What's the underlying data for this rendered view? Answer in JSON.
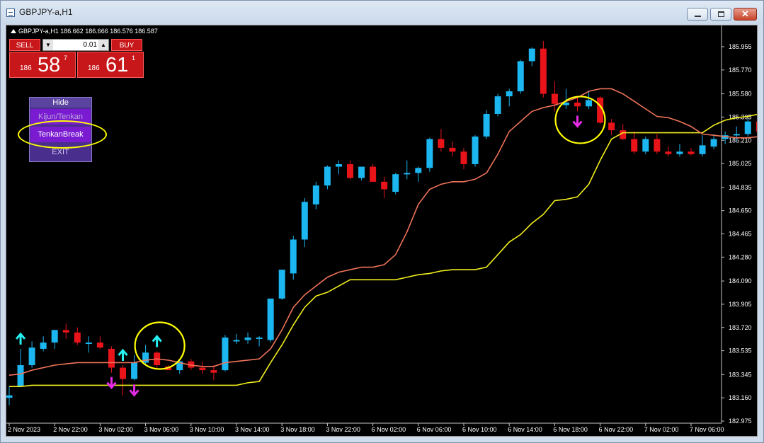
{
  "window": {
    "title": "GBPJPY-a,H1"
  },
  "chart_header": {
    "text": "GBPJPY-a,H1  186.662 186.666 186.576 186.587"
  },
  "trade_panel": {
    "sell_label": "SELL",
    "buy_label": "BUY",
    "lot": "0.01",
    "sell_price": {
      "prefix": "186",
      "big": "58",
      "frac": "7"
    },
    "buy_price": {
      "prefix": "186",
      "big": "61",
      "frac": "1"
    }
  },
  "menu": {
    "hide": "Hide",
    "kijun": "Kijun/Tenkan",
    "tenkan": "TenkanBreak",
    "exit": "EXIT"
  },
  "colors": {
    "bull": "#1cb6f0",
    "bear": "#e8141a",
    "tenkan": "#f0735a",
    "kijun": "#f2ee1c",
    "up_arrow": "#27f0f0",
    "down_arrow": "#e42ce4",
    "highlight": "#ffff00"
  },
  "chart_data": {
    "type": "candlestick",
    "price_ticks": [
      "185.955",
      "185.770",
      "185.580",
      "185.395",
      "185.210",
      "185.025",
      "184.835",
      "184.650",
      "184.465",
      "184.280",
      "184.090",
      "183.905",
      "183.720",
      "183.535",
      "183.345",
      "183.160",
      "182.975"
    ],
    "time_labels": [
      "2 Nov 2023",
      "2 Nov 22:00",
      "3 Nov 02:00",
      "3 Nov 06:00",
      "3 Nov 10:00",
      "3 Nov 14:00",
      "3 Nov 18:00",
      "3 Nov 22:00",
      "6 Nov 02:00",
      "6 Nov 06:00",
      "6 Nov 10:00",
      "6 Nov 14:00",
      "6 Nov 18:00",
      "6 Nov 22:00",
      "7 Nov 02:00",
      "7 Nov 06:00"
    ],
    "ylim": [
      182.975,
      185.955
    ],
    "candles": [
      [
        183.16,
        183.25,
        183.1,
        183.18
      ],
      [
        183.25,
        183.55,
        183.25,
        183.42
      ],
      [
        183.42,
        183.61,
        183.4,
        183.56
      ],
      [
        183.55,
        183.65,
        183.53,
        183.6
      ],
      [
        183.6,
        183.7,
        183.55,
        183.7
      ],
      [
        183.7,
        183.75,
        183.63,
        183.68
      ],
      [
        183.68,
        183.72,
        183.58,
        183.6
      ],
      [
        183.6,
        183.65,
        183.52,
        183.6
      ],
      [
        183.6,
        183.65,
        183.55,
        183.56
      ],
      [
        183.55,
        183.57,
        183.36,
        183.4
      ],
      [
        183.4,
        183.42,
        183.18,
        183.31
      ],
      [
        183.31,
        183.5,
        183.3,
        183.44
      ],
      [
        183.44,
        183.58,
        183.42,
        183.52
      ],
      [
        183.52,
        183.53,
        183.4,
        183.42
      ],
      [
        183.41,
        183.42,
        183.38,
        183.38
      ],
      [
        183.38,
        183.46,
        183.35,
        183.45
      ],
      [
        183.45,
        183.47,
        183.38,
        183.4
      ],
      [
        183.4,
        183.45,
        183.35,
        183.38
      ],
      [
        183.38,
        183.42,
        183.3,
        183.36
      ],
      [
        183.38,
        183.66,
        183.37,
        183.64
      ],
      [
        183.62,
        183.67,
        183.59,
        183.62
      ],
      [
        183.62,
        183.68,
        183.59,
        183.64
      ],
      [
        183.63,
        183.65,
        183.57,
        183.64
      ],
      [
        183.62,
        183.95,
        183.6,
        183.95
      ],
      [
        183.95,
        184.18,
        183.94,
        184.18
      ],
      [
        184.15,
        184.45,
        184.1,
        184.42
      ],
      [
        184.42,
        184.75,
        184.36,
        184.72
      ],
      [
        184.7,
        184.88,
        184.66,
        184.85
      ],
      [
        184.85,
        185.01,
        184.82,
        185.0
      ],
      [
        185.0,
        185.05,
        184.94,
        185.02
      ],
      [
        185.02,
        185.05,
        184.9,
        184.91
      ],
      [
        184.91,
        185.0,
        184.89,
        185.0
      ],
      [
        185.0,
        185.02,
        184.88,
        184.88
      ],
      [
        184.88,
        184.92,
        184.75,
        184.82
      ],
      [
        184.8,
        184.95,
        184.78,
        184.94
      ],
      [
        184.94,
        185.05,
        184.9,
        184.95
      ],
      [
        184.95,
        185.0,
        184.88,
        184.99
      ],
      [
        184.99,
        185.23,
        184.96,
        185.22
      ],
      [
        185.22,
        185.3,
        185.12,
        185.15
      ],
      [
        185.15,
        185.2,
        185.08,
        185.12
      ],
      [
        185.12,
        185.15,
        184.98,
        185.02
      ],
      [
        185.02,
        185.25,
        185.0,
        185.24
      ],
      [
        185.24,
        185.45,
        185.22,
        185.42
      ],
      [
        185.42,
        185.58,
        185.4,
        185.56
      ],
      [
        185.56,
        185.62,
        185.48,
        185.6
      ],
      [
        185.6,
        185.85,
        185.58,
        185.84
      ],
      [
        185.84,
        185.95,
        185.8,
        185.94
      ],
      [
        185.94,
        186.0,
        185.55,
        185.58
      ],
      [
        185.58,
        185.68,
        185.44,
        185.5
      ],
      [
        185.49,
        185.62,
        185.46,
        185.51
      ],
      [
        185.51,
        185.56,
        185.44,
        185.48
      ],
      [
        185.48,
        185.6,
        185.46,
        185.53
      ],
      [
        185.55,
        185.56,
        185.34,
        185.35
      ],
      [
        185.35,
        185.38,
        185.25,
        185.29
      ],
      [
        185.29,
        185.34,
        185.21,
        185.22
      ],
      [
        185.22,
        185.28,
        185.1,
        185.12
      ],
      [
        185.12,
        185.24,
        185.1,
        185.22
      ],
      [
        185.22,
        185.26,
        185.1,
        185.12
      ],
      [
        185.12,
        185.16,
        185.08,
        185.1
      ],
      [
        185.1,
        185.18,
        185.08,
        185.12
      ],
      [
        185.12,
        185.15,
        185.09,
        185.1
      ],
      [
        185.1,
        185.25,
        185.08,
        185.17
      ],
      [
        185.16,
        185.26,
        185.14,
        185.22
      ],
      [
        185.22,
        185.28,
        185.18,
        185.25
      ],
      [
        185.25,
        185.32,
        185.2,
        185.26
      ],
      [
        185.26,
        185.38,
        185.24,
        185.36
      ],
      [
        185.36,
        185.4,
        185.24,
        185.28
      ],
      [
        185.28,
        185.36,
        185.2,
        185.34
      ]
    ],
    "tenkan": [
      183.34,
      183.35,
      183.38,
      183.4,
      183.42,
      183.43,
      183.44,
      183.44,
      183.44,
      183.44,
      183.44,
      183.44,
      183.46,
      183.47,
      183.46,
      183.44,
      183.42,
      183.41,
      183.41,
      183.44,
      183.45,
      183.46,
      183.47,
      183.55,
      183.7,
      183.88,
      183.98,
      184.05,
      184.12,
      184.16,
      184.18,
      184.2,
      184.2,
      184.22,
      184.3,
      184.48,
      184.7,
      184.82,
      184.86,
      184.88,
      184.88,
      184.9,
      184.95,
      185.1,
      185.28,
      185.36,
      185.44,
      185.47,
      185.49,
      185.52,
      185.55,
      185.6,
      185.62,
      185.62,
      185.58,
      185.52,
      185.46,
      185.4,
      185.39,
      185.36,
      185.32,
      185.26,
      185.25,
      185.24,
      185.23,
      185.23,
      185.24,
      185.24
    ],
    "kijun": [
      183.25,
      183.25,
      183.26,
      183.26,
      183.26,
      183.26,
      183.26,
      183.26,
      183.26,
      183.26,
      183.26,
      183.26,
      183.26,
      183.26,
      183.26,
      183.26,
      183.26,
      183.26,
      183.26,
      183.26,
      183.26,
      183.28,
      183.29,
      183.44,
      183.58,
      183.74,
      183.88,
      183.97,
      184.0,
      184.05,
      184.1,
      184.1,
      184.1,
      184.1,
      184.1,
      184.12,
      184.14,
      184.15,
      184.17,
      184.18,
      184.18,
      184.18,
      184.2,
      184.3,
      184.4,
      184.46,
      184.55,
      184.62,
      184.73,
      184.74,
      184.76,
      184.86,
      185.05,
      185.22,
      185.27,
      185.27,
      185.27,
      185.27,
      185.27,
      185.27,
      185.27,
      185.27,
      185.33,
      185.37,
      185.39,
      185.4,
      185.42,
      185.46
    ],
    "up_signals": [
      1,
      10,
      13
    ],
    "down_signals": [
      9,
      11,
      50
    ]
  }
}
